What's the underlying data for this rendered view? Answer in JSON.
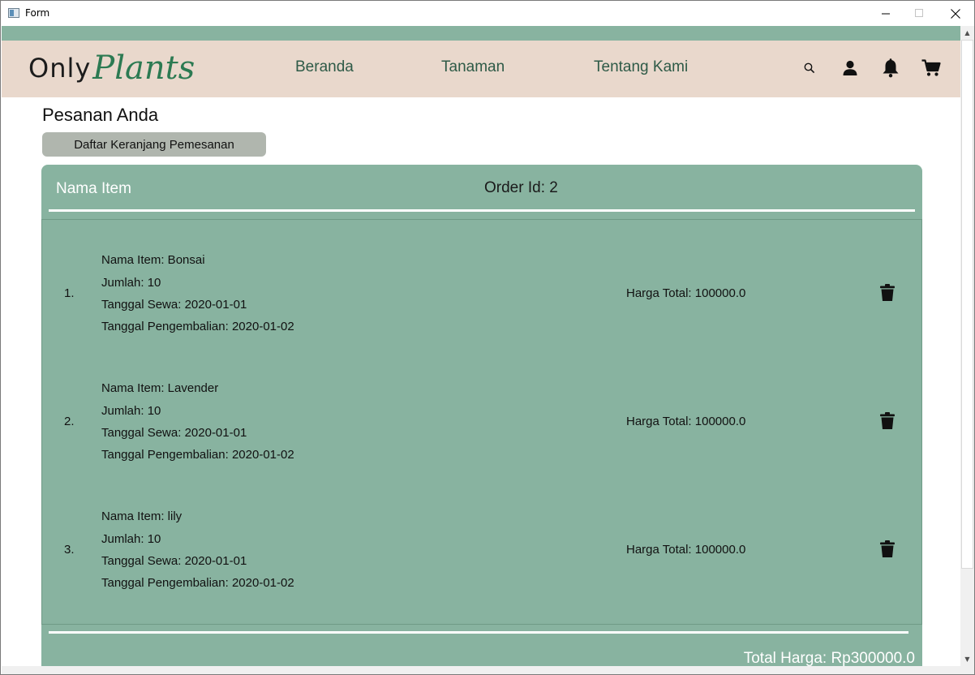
{
  "window": {
    "title": "Form"
  },
  "nav": {
    "logo_only": "Only",
    "logo_plants": "Plants",
    "links": [
      "Beranda",
      "Tanaman",
      "Tentang Kami"
    ],
    "icons": [
      "search-icon",
      "user-icon",
      "bell-icon",
      "cart-icon"
    ]
  },
  "page": {
    "title": "Pesanan Anda",
    "cart_list_button": "Daftar Keranjang Pemesanan"
  },
  "order": {
    "header_name": "Nama Item",
    "order_id": "Order Id: 2",
    "items": [
      {
        "num": "1.",
        "name": "Nama Item: Bonsai",
        "qty": "Jumlah: 10",
        "rent": "Tanggal Sewa: 2020-01-01",
        "return": "Tanggal Pengembalian: 2020-01-02",
        "price": "Harga Total: 100000.0"
      },
      {
        "num": "2.",
        "name": "Nama Item: Lavender",
        "qty": "Jumlah: 10",
        "rent": "Tanggal Sewa: 2020-01-01",
        "return": "Tanggal Pengembalian: 2020-01-02",
        "price": "Harga Total: 100000.0"
      },
      {
        "num": "3.",
        "name": "Nama Item: lily",
        "qty": "Jumlah: 10",
        "rent": "Tanggal Sewa: 2020-01-01",
        "return": "Tanggal Pengembalian: 2020-01-02",
        "price": "Harga Total: 100000.0"
      }
    ],
    "total": "Total Harga: Rp300000.0"
  },
  "colors": {
    "accent_green": "#88b3a0",
    "nav_bg": "#e9d8cc",
    "nav_text": "#2e5a47",
    "logo_green": "#2c7a52",
    "button_gray": "#b0b6ae"
  }
}
